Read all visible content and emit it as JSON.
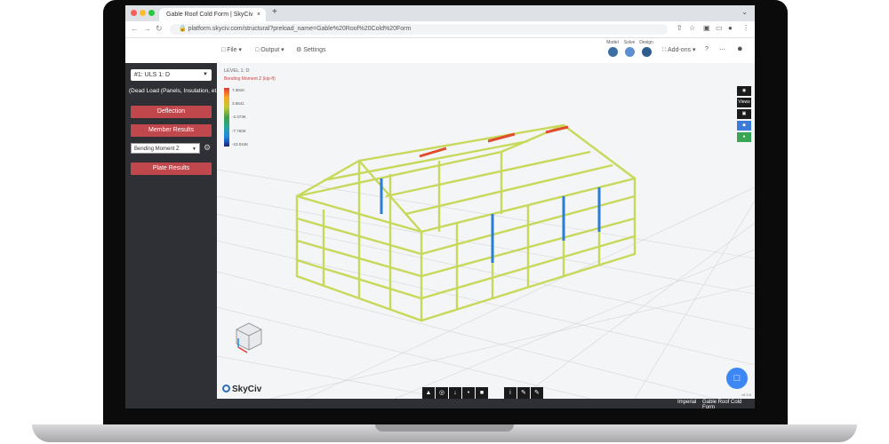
{
  "browser": {
    "tab_title": "Gable Roof Cold Form | SkyCiv",
    "url": "platform.skyciv.com/structural?preload_name=Gable%20Roof%20Cold%20Form",
    "new_tab": "+",
    "tab_close": "×"
  },
  "toolbar": {
    "file": "File",
    "output": "Output",
    "settings": "Settings",
    "tools": [
      {
        "label": "Model"
      },
      {
        "label": "Solve"
      },
      {
        "label": "Design"
      }
    ],
    "add_ons": "Add-ons",
    "help": "?"
  },
  "panel": {
    "load_case": "#1: ULS 1: D",
    "load_desc": "(Dead Load (Panels, Insulation, et...",
    "deflection": "Deflection",
    "member_results": "Member Results",
    "result_type": "Bending Moment Z",
    "plate_results": "Plate Results"
  },
  "viewport": {
    "units_label": "LEVEL 1: D",
    "legend_title": "Bending Moment Z (kip-ft)",
    "legend_values": [
      "7.381K",
      "3.5641",
      "-2.373K",
      "-7.760K",
      "-10.024K"
    ],
    "side_tools": [
      "",
      "Views",
      "",
      "",
      ""
    ],
    "brand": "SkyCiv",
    "version": "v5.3.6",
    "chat_icon": "chat-icon"
  },
  "statusbar": {
    "units": "Imperial",
    "project": "Gable Roof Cold Form"
  },
  "colors": {
    "accent": "#c0484c",
    "panel": "#2e3035",
    "frame": "#c8d85a",
    "member_blue": "#2b7bd8",
    "member_red": "#e04d2a"
  }
}
